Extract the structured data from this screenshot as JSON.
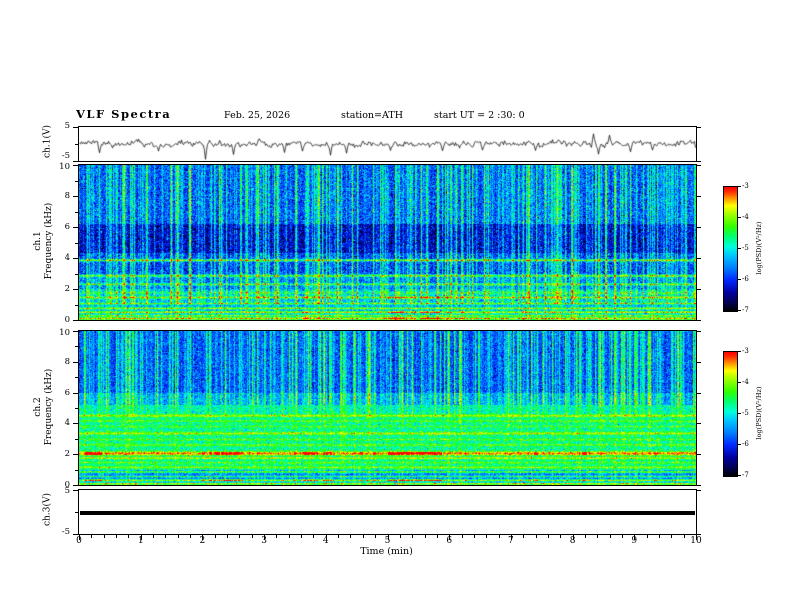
{
  "figure": {
    "title": "VLF  Spectra",
    "date": "Feb. 25, 2026",
    "station": "station=ATH",
    "start_ut": "start UT =  2 :30: 0",
    "time_axis_label": "Time  (min)"
  },
  "axes": {
    "time_ticks": [
      "0",
      "1",
      "2",
      "3",
      "4",
      "5",
      "6",
      "7",
      "8",
      "9",
      "10"
    ],
    "freq_major_ticks": [
      "10",
      "8",
      "6",
      "4",
      "2",
      "0"
    ],
    "freq_minor_ticks": [
      1,
      3,
      5,
      7,
      9
    ],
    "volt_ticks": [
      "5",
      "-5"
    ]
  },
  "panels": {
    "wave1": {
      "ylabel": "ch.1(V)"
    },
    "spec1": {
      "ylabel_line1": "ch.1",
      "ylabel_line2": "Frequency  (kHz)"
    },
    "spec2": {
      "ylabel_line1": "ch.2",
      "ylabel_line2": "Frequency  (kHz)"
    },
    "ch3": {
      "ylabel": "ch.3(V)"
    }
  },
  "colorbar": {
    "label": "log(PSD)(V²/Hz)",
    "ticks": [
      "-3",
      "-4",
      "-5",
      "-6",
      "-7"
    ],
    "stops": [
      {
        "u": 0.0,
        "color": "#000000"
      },
      {
        "u": 0.06,
        "color": "#02024a"
      },
      {
        "u": 0.15,
        "color": "#0000a0"
      },
      {
        "u": 0.25,
        "color": "#0028ff"
      },
      {
        "u": 0.35,
        "color": "#0080ff"
      },
      {
        "u": 0.45,
        "color": "#00c8ff"
      },
      {
        "u": 0.52,
        "color": "#00ffd8"
      },
      {
        "u": 0.6,
        "color": "#00ff70"
      },
      {
        "u": 0.68,
        "color": "#30ff00"
      },
      {
        "u": 0.78,
        "color": "#a0ff00"
      },
      {
        "u": 0.85,
        "color": "#ffff00"
      },
      {
        "u": 0.91,
        "color": "#ff9000"
      },
      {
        "u": 0.96,
        "color": "#ff3000"
      },
      {
        "u": 1.0,
        "color": "#ff0000"
      }
    ]
  },
  "chart_data": {
    "type": "multi-panel",
    "time_range_min": [
      0,
      10
    ],
    "panels": [
      {
        "id": "wave1",
        "type": "line",
        "label": "ch.1(V)",
        "ylim": [
          -5,
          5
        ],
        "baseline_v": 0,
        "noise_amplitude_v": 0.8,
        "seed": 55,
        "spikes": [
          {
            "t": 0.32,
            "v": -2.6
          },
          {
            "t": 1.28,
            "v": -2.1
          },
          {
            "t": 2.05,
            "v": -4.5
          },
          {
            "t": 2.5,
            "v": -3.1
          },
          {
            "t": 3.33,
            "v": -2.5
          },
          {
            "t": 3.62,
            "v": -2.1
          },
          {
            "t": 4.07,
            "v": -3.3
          },
          {
            "t": 4.33,
            "v": -2.7
          },
          {
            "t": 5.05,
            "v": -1.9
          },
          {
            "t": 5.9,
            "v": -2.0
          },
          {
            "t": 6.55,
            "v": -1.8
          },
          {
            "t": 7.4,
            "v": -1.9
          },
          {
            "t": 8.35,
            "v": 3.0
          },
          {
            "t": 8.42,
            "v": -3.0
          },
          {
            "t": 8.6,
            "v": 2.6
          },
          {
            "t": 8.95,
            "v": -2.3
          },
          {
            "t": 9.3,
            "v": -1.8
          }
        ],
        "description": "Channel-1 voltage trace, noisy around 0 V with impulsive spikes"
      },
      {
        "id": "spec1",
        "type": "heatmap",
        "label": "ch.1 spectrogram",
        "freq_range_khz": [
          0,
          10
        ],
        "z_log_psd_range": [
          -7,
          -3
        ],
        "seed": 1337,
        "noise_sigma": 0.35,
        "background": [
          {
            "fmin": 6.2,
            "fmax": 10.01,
            "level": -6.0
          },
          {
            "fmin": 4.3,
            "fmax": 6.2,
            "level": -6.5
          },
          {
            "fmin": 3.0,
            "fmax": 4.3,
            "level": -6.1
          },
          {
            "fmin": 2.0,
            "fmax": 3.0,
            "level": -5.8
          },
          {
            "fmin": 0.0,
            "fmax": 2.0,
            "level": -5.5
          }
        ],
        "bands": [
          {
            "f": 3.85,
            "w": 0.05,
            "level": -4.4
          },
          {
            "f": 2.85,
            "w": 0.05,
            "level": -4.6
          },
          {
            "f": 2.3,
            "w": 0.05,
            "level": -4.7
          },
          {
            "f": 1.75,
            "w": 0.07,
            "level": -4.9
          },
          {
            "f": 1.45,
            "w": 0.05,
            "level": -4.3,
            "hot": true
          },
          {
            "f": 1.05,
            "w": 0.05,
            "level": -4.5
          },
          {
            "f": 0.75,
            "w": 0.05,
            "level": -4.1
          },
          {
            "f": 0.5,
            "w": 0.05,
            "level": -3.9,
            "hot": true
          },
          {
            "f": 0.28,
            "w": 0.05,
            "level": -4.2
          },
          {
            "f": 0.1,
            "w": 0.06,
            "level": -3.7,
            "hot": true
          }
        ],
        "streaks": {
          "density": 0.5,
          "gain": 1.9,
          "profile": [
            {
              "fmin": 1.0,
              "fmax": 10.01,
              "gain": 1.0
            },
            {
              "fmin": 0.0,
              "fmax": 1.0,
              "gain": 0.35
            }
          ]
        },
        "description": "Dense vertical sferic streaks over blue background; dark band 4.3-6.2 kHz; narrowband horizontal lines below 4 kHz with intermittent hot (red) segments"
      },
      {
        "id": "spec2",
        "type": "heatmap",
        "label": "ch.2 spectrogram",
        "freq_range_khz": [
          0,
          10
        ],
        "z_log_psd_range": [
          -7,
          -3
        ],
        "seed": 2024,
        "noise_sigma": 0.3,
        "background": [
          {
            "fmin": 6.0,
            "fmax": 10.01,
            "level": -6.0
          },
          {
            "fmin": 5.2,
            "fmax": 6.0,
            "level": -5.6
          },
          {
            "fmin": 4.6,
            "fmax": 5.2,
            "level": -5.0
          },
          {
            "fmin": 1.0,
            "fmax": 4.6,
            "level": -4.8
          },
          {
            "fmin": 0.0,
            "fmax": 1.0,
            "level": -5.7
          }
        ],
        "bands": [
          {
            "f": 4.5,
            "w": 0.06,
            "level": -3.9
          },
          {
            "f": 4.15,
            "w": 0.05,
            "level": -4.3
          },
          {
            "f": 3.8,
            "w": 0.05,
            "level": -4.4
          },
          {
            "f": 3.35,
            "w": 0.06,
            "level": -3.9
          },
          {
            "f": 2.95,
            "w": 0.05,
            "level": -4.3
          },
          {
            "f": 2.6,
            "w": 0.05,
            "level": -4.2
          },
          {
            "f": 2.05,
            "w": 0.09,
            "level": -3.4,
            "hot": true
          },
          {
            "f": 1.75,
            "w": 0.05,
            "level": -3.9
          },
          {
            "f": 1.45,
            "w": 0.05,
            "level": -4.3
          },
          {
            "f": 1.15,
            "w": 0.05,
            "level": -4.1
          },
          {
            "f": 0.85,
            "w": 0.05,
            "level": -4.3
          },
          {
            "f": 0.55,
            "w": 0.04,
            "level": -4.6
          },
          {
            "f": 0.3,
            "w": 0.05,
            "level": -4.1,
            "hot": true
          },
          {
            "f": 0.08,
            "w": 0.05,
            "level": -3.8
          }
        ],
        "streaks": {
          "density": 0.5,
          "gain": 1.9,
          "profile": [
            {
              "fmin": 5.2,
              "fmax": 10.01,
              "gain": 1.0
            },
            {
              "fmin": 4.6,
              "fmax": 5.2,
              "gain": 0.45
            },
            {
              "fmin": 1.0,
              "fmax": 4.6,
              "gain": 0.18
            },
            {
              "fmin": 0.0,
              "fmax": 1.0,
              "gain": 0.3
            }
          ]
        },
        "description": "Blue with sferic streaks above 5 kHz; broad green emission 1-4.6 kHz with yellow-orange lines, strongest near 2.05 kHz; darker 0-1 kHz band with narrow lines"
      },
      {
        "id": "ch3",
        "type": "line",
        "label": "ch.3(V)",
        "ylim": [
          -5,
          5
        ],
        "value_v": -0.2,
        "line_thickness_px": 4,
        "description": "Constant flat heavy trace near 0 V"
      }
    ]
  }
}
